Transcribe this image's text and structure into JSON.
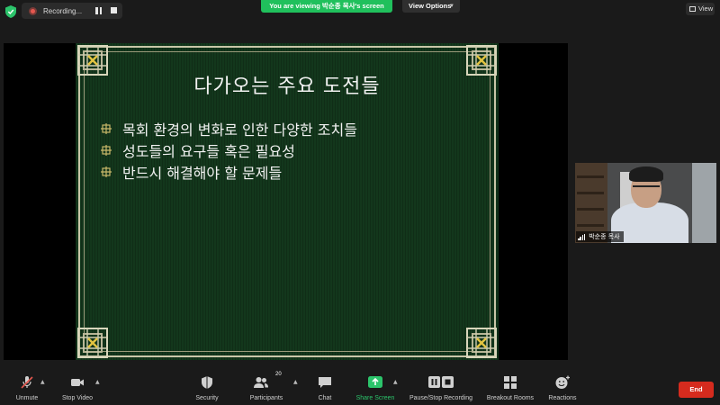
{
  "top_bar": {
    "recording_label": "Recording...",
    "viewing_banner": "You are viewing 박순종 목사's screen",
    "view_options_label": "View Options",
    "view_button_label": "View"
  },
  "slide": {
    "title": "다가오는 주요 도전들",
    "bullets": [
      "목회 환경의 변화로 인한 다양한 조치들",
      "성도들의 요구들 혹은 필요성",
      "반드시 해결해야 할 문제들"
    ]
  },
  "participant": {
    "name": "박순종 목사"
  },
  "toolbar": {
    "unmute": "Unmute",
    "stop_video": "Stop Video",
    "security": "Security",
    "participants": "Participants",
    "participants_count": "20",
    "chat": "Chat",
    "share_screen": "Share Screen",
    "pause_stop_recording": "Pause/Stop Recording",
    "breakout_rooms": "Breakout Rooms",
    "reactions": "Reactions",
    "end": "End"
  },
  "colors": {
    "background": "#1a1a1a",
    "banner_green": "#20c05c",
    "slide_green": "#13371c",
    "end_red": "#d52b1e",
    "share_green": "#2cc46b",
    "mute_red": "#e5574f"
  },
  "icons": [
    "shield-icon",
    "record-dot-icon",
    "pause-icon",
    "stop-icon",
    "grid-icon",
    "microphone-muted-icon",
    "video-camera-icon",
    "security-shield-icon",
    "participants-icon",
    "chat-bubble-icon",
    "share-screen-arrow-icon",
    "pause-stop-recording-icon",
    "breakout-rooms-icon",
    "reactions-icon",
    "signal-strength-icon",
    "caret-up-icon",
    "chevron-down-icon"
  ]
}
